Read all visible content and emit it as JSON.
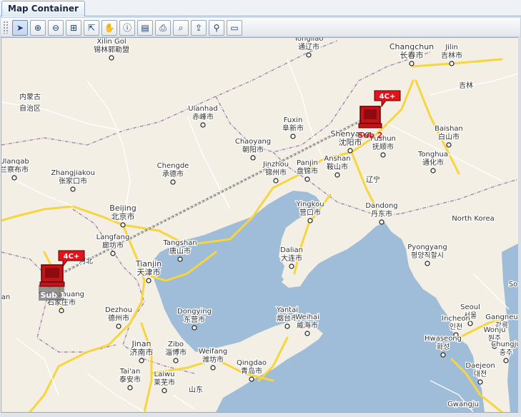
{
  "window": {
    "tab_title": "Map Container"
  },
  "toolbar": {
    "tools": [
      {
        "name": "select-arrow-icon",
        "glyph": "➤"
      },
      {
        "name": "zoom-in-icon",
        "glyph": "⊕"
      },
      {
        "name": "zoom-out-icon",
        "glyph": "⊖"
      },
      {
        "name": "zoom-region-icon",
        "glyph": "⊞"
      },
      {
        "name": "zoom-extent-icon",
        "glyph": "⇱"
      },
      {
        "name": "pan-hand-icon",
        "glyph": "✋"
      },
      {
        "name": "identify-icon",
        "glyph": "ⓘ"
      },
      {
        "name": "layer-icon",
        "glyph": "▤"
      },
      {
        "name": "print-icon",
        "glyph": "⎙"
      },
      {
        "name": "print-preview-icon",
        "glyph": "⌕"
      },
      {
        "name": "export-icon",
        "glyph": "⇪"
      },
      {
        "name": "search-icon",
        "glyph": "⚲"
      },
      {
        "name": "measure-ruler-icon",
        "glyph": "▭"
      }
    ]
  },
  "map": {
    "places": [
      {
        "key": "xilingol",
        "en": "Xilin Gol",
        "zh": "锡林郭勒盟"
      },
      {
        "key": "tongliao",
        "en": "Tongliao",
        "zh": "通辽市"
      },
      {
        "key": "changchun",
        "en": "Changchun",
        "zh": "长春市"
      },
      {
        "key": "jilin",
        "en": "Jilin",
        "zh": "吉林市"
      },
      {
        "key": "jilin_prov",
        "en": "",
        "zh": "吉林"
      },
      {
        "key": "neimenggu",
        "en": "",
        "zh": "内蒙古"
      },
      {
        "key": "zizhiqu",
        "en": "",
        "zh": "自治区"
      },
      {
        "key": "ulanhad",
        "en": "Ulanhad",
        "zh": "赤峰市"
      },
      {
        "key": "fuxin",
        "en": "Fuxin",
        "zh": "阜新市"
      },
      {
        "key": "shenyang",
        "en": "Shenyang",
        "zh": "沈阳市"
      },
      {
        "key": "fushun",
        "en": "Fushun",
        "zh": "抚顺市"
      },
      {
        "key": "baishan",
        "en": "Baishan",
        "zh": "白山市"
      },
      {
        "key": "chaoyang",
        "en": "Chaoyang",
        "zh": "朝阳市"
      },
      {
        "key": "jinzhou",
        "en": "Jinzhou",
        "zh": "锦州市"
      },
      {
        "key": "panjin",
        "en": "Panjin",
        "zh": "盘锦市"
      },
      {
        "key": "anshan",
        "en": "Anshan",
        "zh": "鞍山市"
      },
      {
        "key": "liaoning",
        "en": "",
        "zh": "辽宁"
      },
      {
        "key": "tonghua",
        "en": "Tonghua",
        "zh": "通化市"
      },
      {
        "key": "ulanqab",
        "en": "Ulanqab",
        "zh": "兰察布市"
      },
      {
        "key": "zhangjiakou",
        "en": "Zhangjiakou",
        "zh": "张家口市"
      },
      {
        "key": "chengde",
        "en": "Chengde",
        "zh": "承德市"
      },
      {
        "key": "yingkou",
        "en": "Yingkou",
        "zh": "营口市"
      },
      {
        "key": "dandong",
        "en": "Dandong",
        "zh": "丹东市"
      },
      {
        "key": "north_korea",
        "en": "North Korea",
        "zh": ""
      },
      {
        "key": "beijing",
        "en": "Beijing",
        "zh": "北京市"
      },
      {
        "key": "langfang",
        "en": "Langfang",
        "zh": "廊坊市"
      },
      {
        "key": "tangshan",
        "en": "Tangshan",
        "zh": "唐山市"
      },
      {
        "key": "hebei",
        "en": "",
        "zh": "河北"
      },
      {
        "key": "tianjin",
        "en": "Tianjin",
        "zh": "天津市"
      },
      {
        "key": "dalian",
        "en": "Dalian",
        "zh": "大连市"
      },
      {
        "key": "pyongyang",
        "en": "Pyongyang",
        "zh": "평양직할시"
      },
      {
        "key": "shijiazhuang",
        "en": "Shijiazhuang",
        "zh": "石家庄市"
      },
      {
        "key": "dezhou",
        "en": "Dezhou",
        "zh": "德州市"
      },
      {
        "key": "dongying",
        "en": "Dongying",
        "zh": "东营市"
      },
      {
        "key": "yantai",
        "en": "Yantai",
        "zh": "烟台市"
      },
      {
        "key": "weihai",
        "en": "Weihai",
        "zh": "威海市"
      },
      {
        "key": "seoul",
        "en": "Seoul",
        "zh": "서울"
      },
      {
        "key": "incheon",
        "en": "Incheon",
        "zh": "인천"
      },
      {
        "key": "gangneung",
        "en": "Gangneu",
        "zh": "강릉"
      },
      {
        "key": "jinan",
        "en": "Jinan",
        "zh": "济南市"
      },
      {
        "key": "zibo",
        "en": "Zibo",
        "zh": "淄博市"
      },
      {
        "key": "weifang",
        "en": "Weifang",
        "zh": "潍坊市"
      },
      {
        "key": "hwaseong",
        "en": "Hwaseong",
        "zh": "화성"
      },
      {
        "key": "wonju",
        "en": "Wonju",
        "zh": "원주"
      },
      {
        "key": "chungju",
        "en": "Chungju",
        "zh": "충주"
      },
      {
        "key": "taian",
        "en": "Tai'an",
        "zh": "泰安市"
      },
      {
        "key": "laiwu",
        "en": "Laiwu",
        "zh": "莱芜市"
      },
      {
        "key": "shandong",
        "en": "",
        "zh": "山东"
      },
      {
        "key": "qingdao",
        "en": "Qingdao",
        "zh": "青岛市"
      },
      {
        "key": "daejeon",
        "en": "Daejeon",
        "zh": "대전"
      },
      {
        "key": "gwangju",
        "en": "Gwangju",
        "zh": ""
      },
      {
        "key": "an_edge",
        "en": "an",
        "zh": ""
      },
      {
        "key": "so_edge",
        "en": "So",
        "zh": ""
      }
    ],
    "nodes": [
      {
        "key": "sub1",
        "label": "Sub 1",
        "badge": "4C+"
      },
      {
        "key": "sub2",
        "label": "Sub 2",
        "badge": "4C+"
      }
    ],
    "colors": {
      "sea": "#9fbcd8",
      "land": "#f3efe4",
      "highway": "#f6d53e",
      "road": "#ffffff",
      "border": "#a286b0",
      "alert": "#e0141c",
      "link": "#8a8a8a"
    }
  }
}
